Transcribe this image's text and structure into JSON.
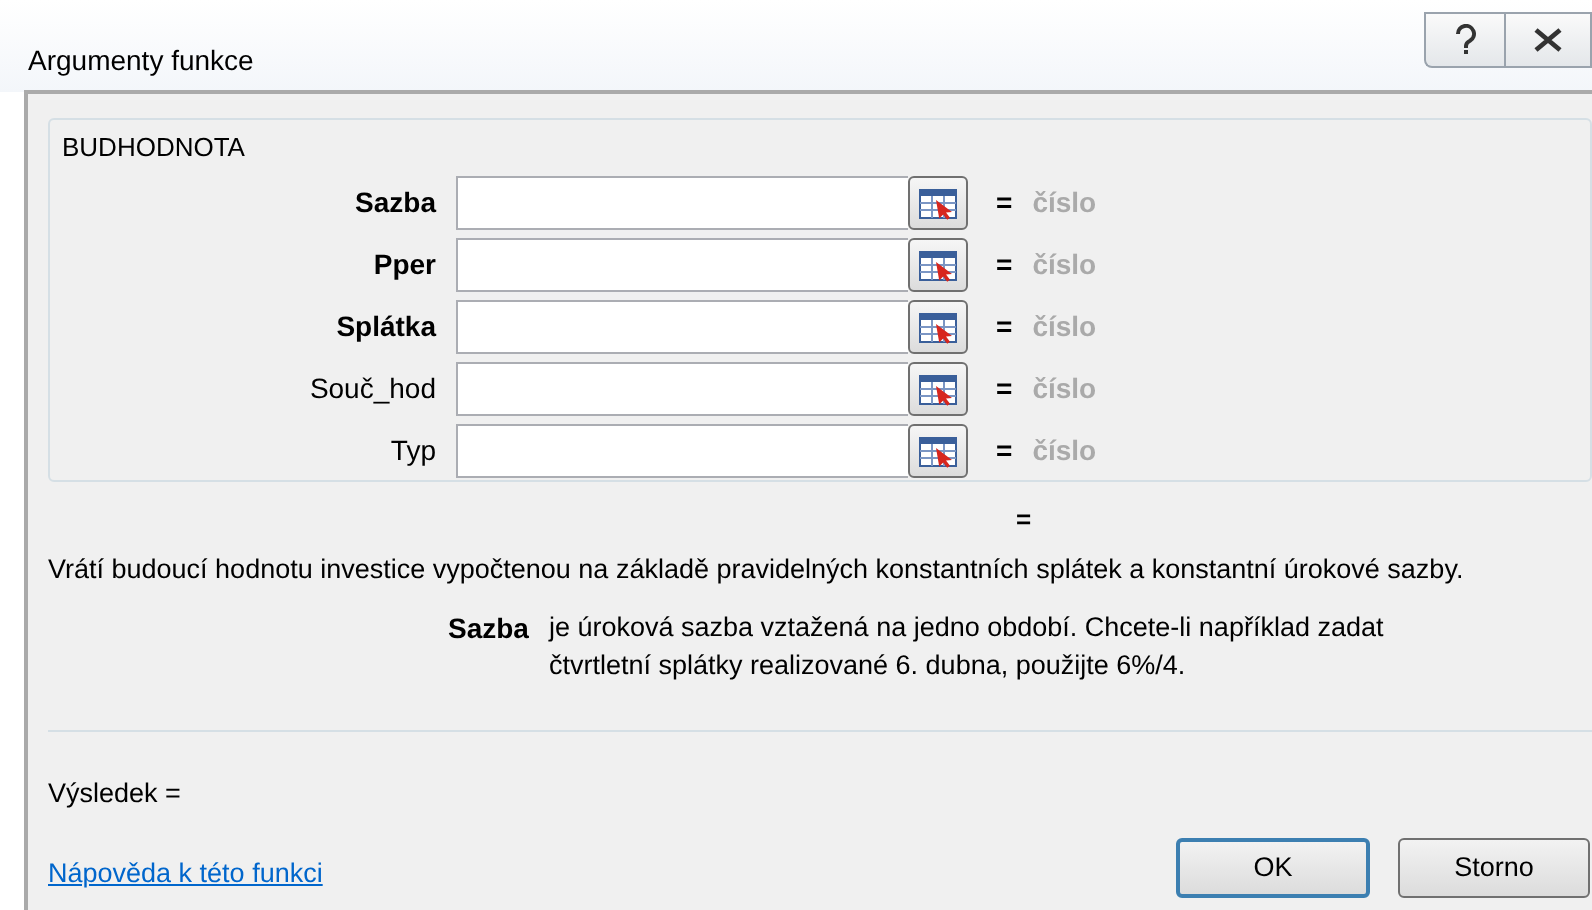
{
  "window": {
    "title": "Argumenty funkce"
  },
  "function_group": {
    "title": "BUDHODNOTA",
    "arguments": [
      {
        "name": "Sazba",
        "required": true,
        "equals": "=",
        "placeholder_result": "číslo"
      },
      {
        "name": "Pper",
        "required": true,
        "equals": "=",
        "placeholder_result": "číslo"
      },
      {
        "name": "Splátka",
        "required": true,
        "equals": "=",
        "placeholder_result": "číslo"
      },
      {
        "name": "Souč_hod",
        "required": false,
        "equals": "=",
        "placeholder_result": "číslo"
      },
      {
        "name": "Typ",
        "required": false,
        "equals": "=",
        "placeholder_result": "číslo"
      }
    ]
  },
  "formula_result": "=",
  "description": "Vrátí budoucí hodnotu investice vypočtenou na základě pravidelných konstantních splátek a konstantní úrokové sazby.",
  "argument_help": {
    "name": "Sazba",
    "text": "je úroková sazba vztažená na jedno období. Chcete-li například zadat čtvrtletní splátky realizované 6. dubna, použijte 6%/4."
  },
  "result": "Výsledek =",
  "help_link": "Nápověda k této funkci",
  "buttons": [
    {
      "label": "OK",
      "default": true
    },
    {
      "label": "Storno",
      "default": false
    }
  ]
}
